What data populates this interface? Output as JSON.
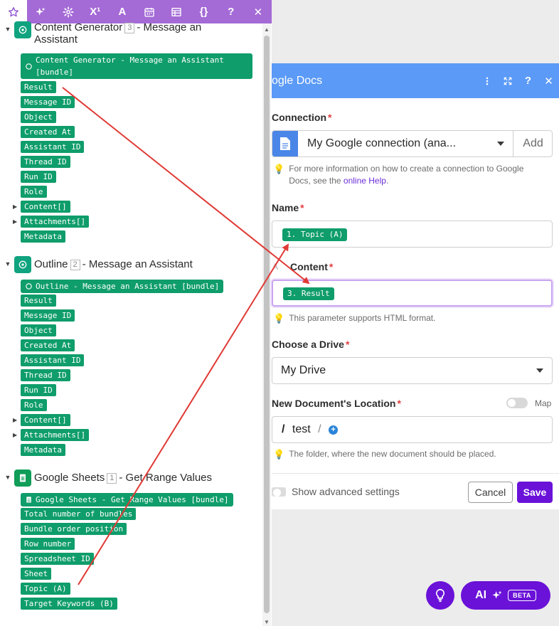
{
  "toolbar": {
    "items": [
      "favorites",
      "ai-tools",
      "settings",
      "math",
      "text",
      "date",
      "table",
      "json",
      "help",
      "close"
    ],
    "math_label": "X¹",
    "text_label": "A",
    "json_label": "{}",
    "help_label": "?",
    "close_label": "✕"
  },
  "left_panel": {
    "modules": [
      {
        "title": "Content Generator",
        "number": "3",
        "subtitle": "- Message an Assistant",
        "bundle_label": "Content Generator - Message an Assistant [bundle]",
        "items": [
          "Result",
          "Message ID",
          "Object",
          "Created At",
          "Assistant ID",
          "Thread ID",
          "Run ID",
          "Role",
          "Content[]",
          "Attachments[]",
          "Metadata"
        ]
      },
      {
        "title": "Outline",
        "number": "2",
        "subtitle": "- Message an Assistant",
        "bundle_label": "Outline - Message an Assistant [bundle]",
        "items": [
          "Result",
          "Message ID",
          "Object",
          "Created At",
          "Assistant ID",
          "Thread ID",
          "Run ID",
          "Role",
          "Content[]",
          "Attachments[]",
          "Metadata"
        ]
      },
      {
        "title": "Google Sheets",
        "number": "1",
        "subtitle": "- Get Range Values",
        "bundle_label": "Google Sheets - Get Range Values [bundle]",
        "items": [
          "Total number of bundles",
          "Bundle order position",
          "Row number",
          "Spreadsheet ID",
          "Sheet",
          "Topic (A)",
          "Target Keywords (B)"
        ]
      }
    ]
  },
  "modal": {
    "title": "ogle Docs",
    "connection": {
      "label": "Connection",
      "required": "*",
      "value": "My Google connection (ana...",
      "add_label": "Add",
      "hint_text": "For more information on how to create a connection to Google Docs, see the",
      "hint_link": "online Help",
      "hint_end": "."
    },
    "name": {
      "label": "Name",
      "required": "*",
      "tag": "1. Topic (A)"
    },
    "content": {
      "label": "Content",
      "required": "*",
      "tag": "3. Result",
      "hint": "This parameter supports HTML format."
    },
    "drive": {
      "label": "Choose a Drive",
      "required": "*",
      "value": "My Drive"
    },
    "location": {
      "label": "New Document's Location",
      "required": "*",
      "map_label": "Map",
      "path_sep": "/",
      "path_folder": "test",
      "hint": "The folder, where the new document should be placed."
    },
    "footer": {
      "advanced_label": "Show advanced settings",
      "cancel_label": "Cancel",
      "save_label": "Save"
    }
  },
  "fab": {
    "ai_label": "AI",
    "beta_label": "BETA"
  },
  "colors": {
    "toolbar": "#a46ad6",
    "pill": "#0f9d6b",
    "modal_header": "#5b9af7",
    "save_button": "#6a12d8",
    "arrow": "#e03a35",
    "link": "#6b2fd8"
  }
}
